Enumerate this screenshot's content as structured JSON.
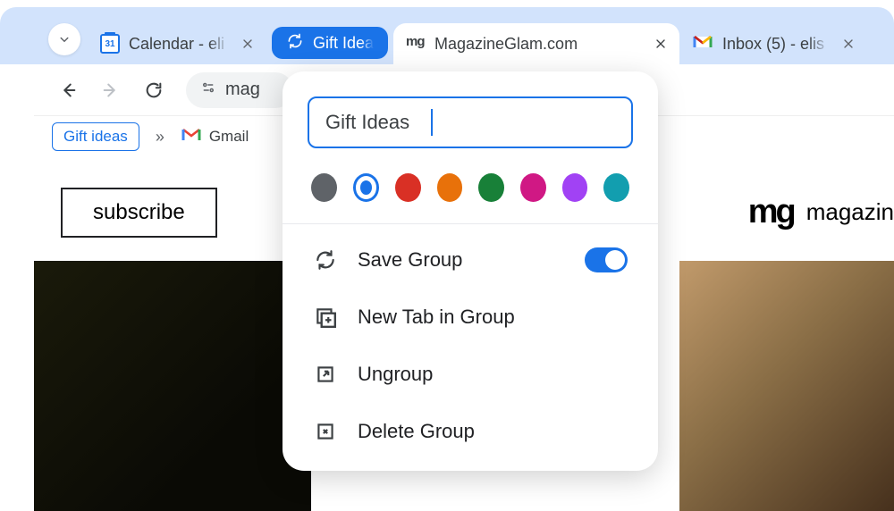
{
  "tabstrip": {
    "tabs": [
      {
        "title": "Calendar - eli"
      },
      {
        "title": "Gift Ideas"
      },
      {
        "title": "MagazineGlam.com"
      },
      {
        "title": "Inbox (5) - elis"
      }
    ]
  },
  "toolbar": {
    "url_fragment": "mag"
  },
  "bookmarks": {
    "chip": "Gift ideas",
    "gmail": "Gmail"
  },
  "page": {
    "subscribe": "subscribe",
    "logo": "mg",
    "site_name": "magazin"
  },
  "menu": {
    "group_name": "Gift Ideas",
    "colors": {
      "grey": "#5f6368",
      "blue": "#1a73e8",
      "red": "#d93025",
      "orange": "#e8710a",
      "green": "#188038",
      "pink": "#d01884",
      "purple": "#a142f4",
      "cyan": "#129eaf"
    },
    "selected_color": "blue",
    "items": {
      "save": "Save Group",
      "newtab": "New Tab in Group",
      "ungroup": "Ungroup",
      "delete": "Delete Group"
    },
    "save_toggle": true
  }
}
